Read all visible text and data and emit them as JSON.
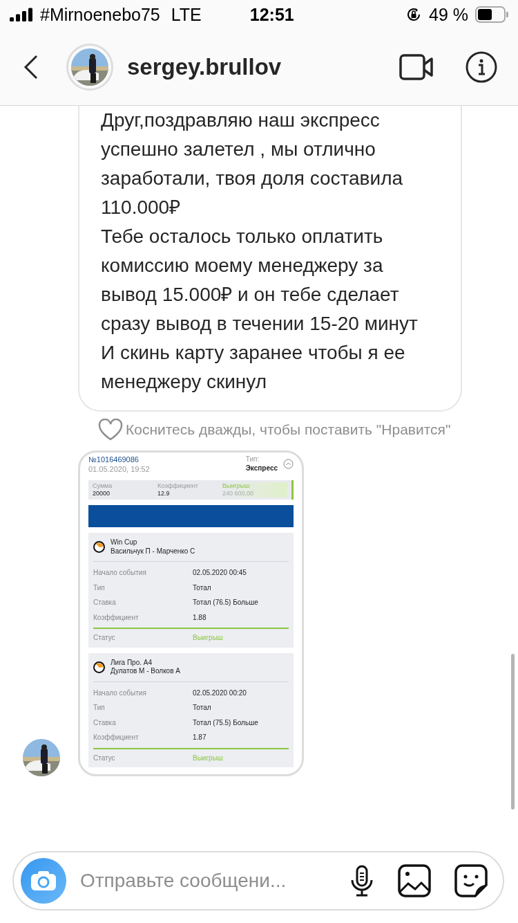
{
  "status_bar": {
    "carrier": "#Mirnoenebo75",
    "network": "LTE",
    "time": "12:51",
    "battery": "49 %"
  },
  "header": {
    "username": "sergey.brullov"
  },
  "message": {
    "paragraphs": [
      "Друг,поздравляю наш экспресс успешно залетел , мы отлично заработали, твоя доля составила 110.000₽",
      "Тебе осталось только оплатить комиссию моему менеджеру за вывод 15.000₽ и он тебе сделает сразу вывод в течении 15-20 минут",
      "И скинь карту заранее чтобы я ее менеджеру скинул"
    ],
    "like_hint": "Коснитесь дважды, чтобы поставить \"Нравится\""
  },
  "bet_slip": {
    "number": "№1016469086",
    "date": "01.05.2020, 19:52",
    "type_label": "Тип:",
    "type_value": "Экспресс",
    "summary": [
      {
        "label": "Сумма",
        "value": "20000",
        "kind": "plain"
      },
      {
        "label": "Коэффициент",
        "value": "12.9",
        "kind": "plain"
      },
      {
        "label": "Выигрыш",
        "value": "240 600,00",
        "kind": "win"
      }
    ],
    "events": [
      {
        "league": "Win Cup",
        "match": "Васильчук П - Марченко С",
        "rows": [
          {
            "label": "Начало события",
            "value": "02.05.2020 00:45"
          },
          {
            "label": "Тип",
            "value": "Тотал"
          },
          {
            "label": "Ставка",
            "value": "Тотал (76.5) Больше"
          },
          {
            "label": "Коэффициент",
            "value": "1.88"
          }
        ],
        "status_label": "Статус",
        "status_value": "Выигрыш"
      },
      {
        "league": "Лига Про. А4",
        "match": "Дулатов М - Волков А",
        "rows": [
          {
            "label": "Начало события",
            "value": "02.05.2020 00:20"
          },
          {
            "label": "Тип",
            "value": "Тотал"
          },
          {
            "label": "Ставка",
            "value": "Тотал (75.5) Больше"
          },
          {
            "label": "Коэффициент",
            "value": "1.87"
          }
        ],
        "status_label": "Статус",
        "status_value": "Выигрыш"
      }
    ]
  },
  "composer": {
    "placeholder": "Отправьте сообщени..."
  }
}
